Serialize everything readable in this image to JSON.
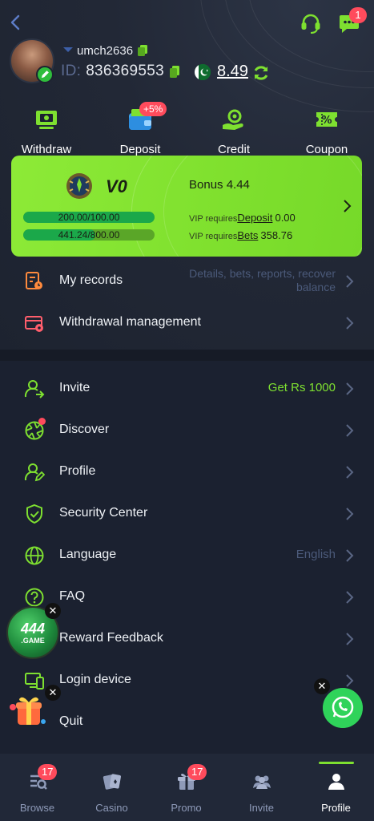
{
  "user": {
    "username": "umch2636",
    "id_label": "ID:",
    "id_value": "836369553",
    "balance": "8.49"
  },
  "header": {
    "message_badge": "1"
  },
  "quick_actions": [
    {
      "label": "Withdraw",
      "icon": "withdraw-icon"
    },
    {
      "label": "Deposit",
      "icon": "wallet-icon",
      "badge": "+5%"
    },
    {
      "label": "Credit",
      "icon": "credit-icon"
    },
    {
      "label": "Coupon",
      "icon": "coupon-icon"
    }
  ],
  "vip": {
    "level": "V0",
    "bonus": "Bonus 4.44",
    "deposit_progress": "200.00/100.00",
    "deposit_fraction": 1.0,
    "bets_progress": "441.24/800.00",
    "bets_fraction": 0.55,
    "req_prefix": "VIP requires",
    "deposit_link": "Deposit",
    "deposit_value": "0.00",
    "bets_link": "Bets",
    "bets_value": "358.76"
  },
  "menu_top": [
    {
      "label": "My records",
      "value": "Details, bets, reports, recover balance"
    },
    {
      "label": "Withdrawal management"
    }
  ],
  "menu_main": [
    {
      "label": "Invite",
      "value": "Get Rs 1000"
    },
    {
      "label": "Discover"
    },
    {
      "label": "Profile"
    },
    {
      "label": "Security Center"
    },
    {
      "label": "Language",
      "value": "English"
    },
    {
      "label": "FAQ"
    },
    {
      "label": "Reward Feedback"
    },
    {
      "label": "Login device"
    },
    {
      "label": "Quit"
    }
  ],
  "floating": {
    "game_logo_line1": "444",
    "game_logo_line2": ".GAME"
  },
  "tabs": [
    {
      "label": "Browse",
      "badge": "17"
    },
    {
      "label": "Casino"
    },
    {
      "label": "Promo",
      "badge": "17"
    },
    {
      "label": "Invite"
    },
    {
      "label": "Profile",
      "active": true
    }
  ],
  "colors": {
    "accent": "#7ee030",
    "background": "#1b2130",
    "badge": "#ff4b5c"
  }
}
